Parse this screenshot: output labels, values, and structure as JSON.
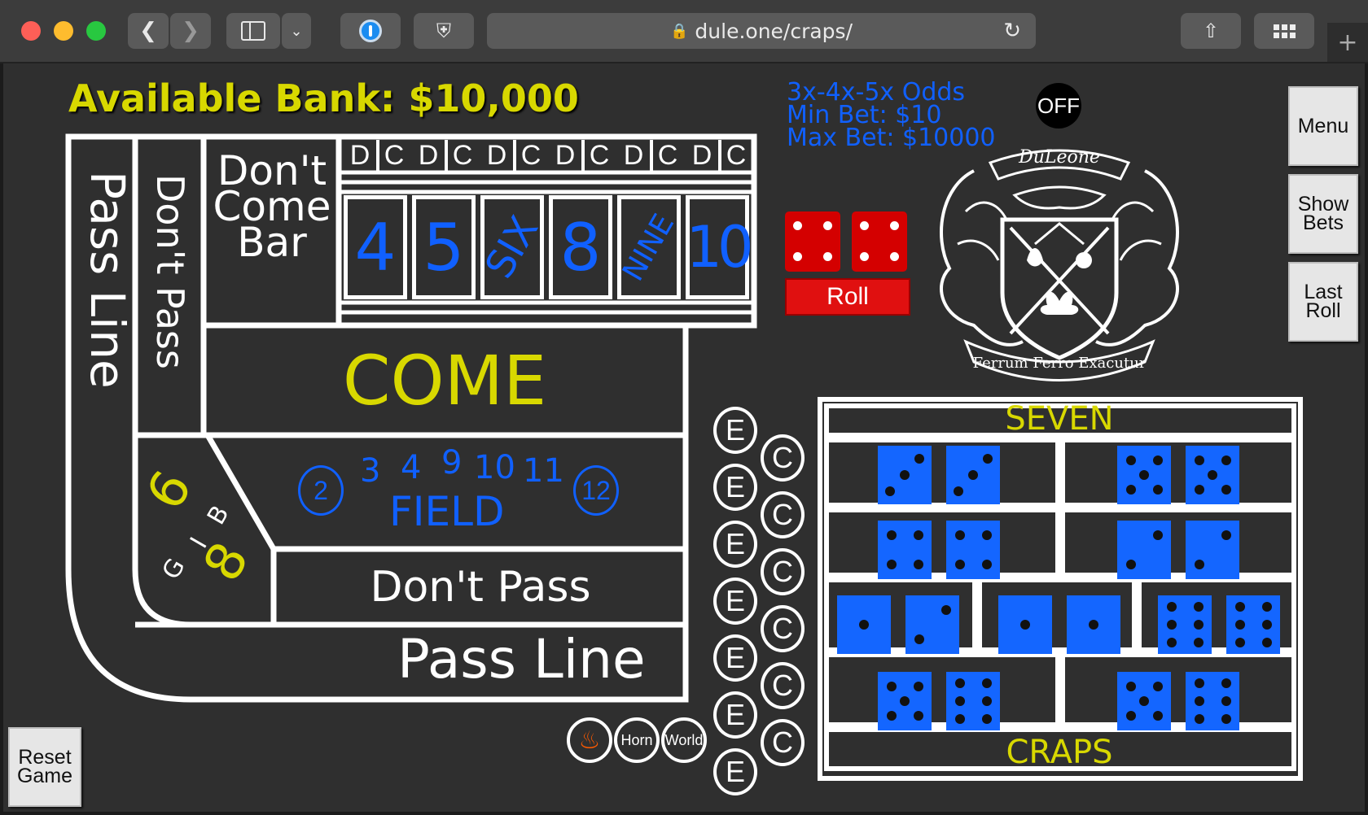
{
  "browser": {
    "url": "dule.one/craps/",
    "icons": [
      "back-icon",
      "forward-icon",
      "sidebar-icon",
      "chevron-down-icon",
      "password-manager-icon",
      "shield-icon",
      "lock-icon",
      "reload-icon",
      "share-icon",
      "grid-icon",
      "plus-icon"
    ]
  },
  "bank": {
    "label": "Available Bank: $10,000"
  },
  "odds_info": {
    "line1": "3x-4x-5x Odds",
    "line2": "Min Bet: $10",
    "line3": "Max Bet: $10000"
  },
  "puck": {
    "label": "OFF"
  },
  "roll_button": {
    "label": "Roll"
  },
  "crest": {
    "top_text": "DuLeone",
    "motto": "Ferrum Ferro Exacutur"
  },
  "side_buttons": {
    "menu": "Menu",
    "show_bets_1": "Show",
    "show_bets_2": "Bets",
    "last_roll_1": "Last",
    "last_roll_2": "Roll"
  },
  "reset": {
    "line1": "Reset",
    "line2": "Game"
  },
  "table": {
    "pass_line_vertical": "Pass Line",
    "dont_pass_vertical": "Don't Pass",
    "dont_come_1": "Don't",
    "dont_come_2": "Come",
    "dont_come_3": "Bar",
    "dc_d": "D",
    "dc_c": "C",
    "numbers": [
      "4",
      "5",
      "SIX",
      "8",
      "NINE",
      "10"
    ],
    "come": "COME",
    "field": {
      "label": "FIELD",
      "two": "2",
      "twelve": "12",
      "three": "3",
      "four": "4",
      "nine": "9",
      "ten": "10",
      "eleven": "11"
    },
    "big_six": "6",
    "big_eight": "8",
    "big_b": "B",
    "big_i": "I",
    "big_g": "G",
    "dont_pass": "Don't Pass",
    "pass_line": "Pass Line"
  },
  "ec": {
    "e": "E",
    "c": "C"
  },
  "bottom_bets": {
    "horn": "Horn",
    "world": "World"
  },
  "prop": {
    "seven": "SEVEN",
    "craps": "CRAPS"
  },
  "colors": {
    "felt": "#2f2f2f",
    "blue": "#1060ff",
    "yellow": "#d8d800",
    "dice_red": "#d40000"
  }
}
